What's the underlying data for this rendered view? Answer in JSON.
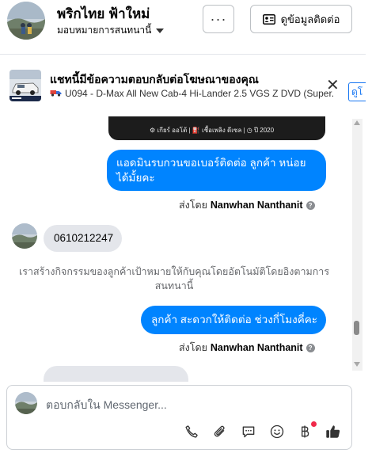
{
  "header": {
    "page_name": "พริกไทย ฟ้าใหม่",
    "label_select": "มอบหมายการสนทนานี้",
    "more_button": "···",
    "view_contact_button": "ดูข้อมูลติดต่อ"
  },
  "ad_banner": {
    "title": "แชทนี้มีข้อความตอบกลับต่อโฆษณาของคุณ",
    "subtitle": "U094 - D-Max All New Cab-4 Hi-Lander 2.5 VGS Z DVD (Super...",
    "tag_peek": "ดูโ"
  },
  "messages": {
    "card_meta": "⚙ เกียร์ ออโต้   |   ⛽ เชื้อเพลิง ดีเซล   |   ◷ ปี 2020",
    "outgoing_1": "แอดมินรบกวนขอเบอร์ติดต่อ ลูกค้า  หน่อยได้มั้ยคะ",
    "sent_by_prefix_1": "ส่งโดย",
    "sent_by_name_1": "Nanwhan Nanthanit",
    "incoming_1": "0610212247",
    "system_notice": "เราสร้างกิจกรรมของลูกค้าเป้าหมายให้กับคุณโดยอัตโนมัติโดยอิงตามการสนทนานี้",
    "outgoing_2": "ลูกค้า  สะดวกให้ติดต่อ ช่วงกี่โมงคี่คะ",
    "sent_by_prefix_2": "ส่งโดย",
    "sent_by_name_2": "Nanwhan Nanthanit"
  },
  "composer": {
    "placeholder": "ตอบกลับใน Messenger..."
  },
  "toolbar_icons": [
    "phone-icon",
    "paperclip-icon",
    "chat-bubble-icon",
    "emoji-icon",
    "baht-icon",
    "thumbs-up-icon"
  ],
  "colors": {
    "outgoing_bubble": "#0084ff",
    "incoming_bubble": "#e4e6eb",
    "notification_dot": "#f02849"
  }
}
